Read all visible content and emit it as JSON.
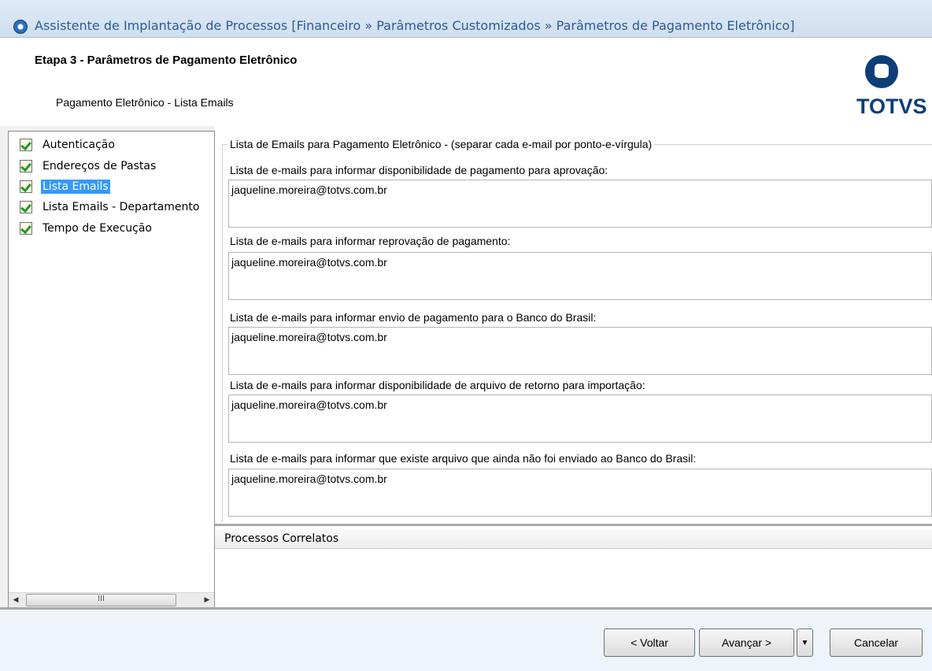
{
  "window": {
    "title": "Assistente de Implantação de Processos [Financeiro » Parâmetros Customizados  » Parâmetros de Pagamento Eletrônico]"
  },
  "header": {
    "step_title": "Etapa 3 - Parâmetros de Pagamento Eletrônico",
    "subtitle": "Pagamento Eletrônico - Lista Emails",
    "logo_text": "TOTVS"
  },
  "tree": {
    "items": [
      {
        "label": "Autenticação",
        "selected": false
      },
      {
        "label": "Endereços de Pastas",
        "selected": false
      },
      {
        "label": "Lista Emails",
        "selected": true
      },
      {
        "label": "Lista Emails - Departamento",
        "selected": false
      },
      {
        "label": "Tempo de Execução",
        "selected": false
      }
    ],
    "scroll_thumb_glyph": "III"
  },
  "group": {
    "legend": "Lista de Emails para Pagamento Eletrônico - (separar cada e-mail por ponto-e-vírgula)",
    "fields": [
      {
        "label": "Lista de e-mails para informar disponibilidade de pagamento para aprovação:",
        "value": "jaqueline.moreira@totvs.com.br"
      },
      {
        "label": "Lista de e-mails para informar reprovação de pagamento:",
        "value": "jaqueline.moreira@totvs.com.br"
      },
      {
        "label": "Lista de e-mails para informar envio de pagamento para o Banco do Brasil:",
        "value": "jaqueline.moreira@totvs.com.br"
      },
      {
        "label": "Lista de e-mails para informar disponibilidade de arquivo de retorno para importação:",
        "value": "jaqueline.moreira@totvs.com.br"
      },
      {
        "label": "Lista de e-mails para informar que existe arquivo que ainda não foi enviado ao Banco do Brasil:",
        "value": "jaqueline.moreira@totvs.com.br"
      }
    ]
  },
  "related": {
    "label": "Processos Correlatos"
  },
  "footer": {
    "back_label": "< Voltar",
    "next_label": "Avançar >",
    "dropdown_glyph": "▼",
    "cancel_label": "Cancelar"
  }
}
